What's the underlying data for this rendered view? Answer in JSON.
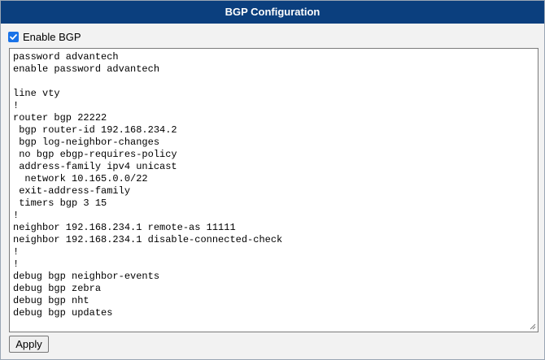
{
  "window": {
    "title": "BGP Configuration"
  },
  "enable_bgp": {
    "label": "Enable BGP",
    "checked": true,
    "check_color": "#1a73e8"
  },
  "config": {
    "text": "password advantech\nenable password advantech\n\nline vty\n!\nrouter bgp 22222\n bgp router-id 192.168.234.2\n bgp log-neighbor-changes\n no bgp ebgp-requires-policy\n address-family ipv4 unicast\n  network 10.165.0.0/22\n exit-address-family\n timers bgp 3 15\n!\nneighbor 192.168.234.1 remote-as 11111\nneighbor 192.168.234.1 disable-connected-check\n!\n!\ndebug bgp neighbor-events\ndebug bgp zebra\ndebug bgp nht\ndebug bgp updates"
  },
  "actions": {
    "apply_label": "Apply"
  },
  "colors": {
    "title_bar": "#0b3f7e",
    "panel_bg": "#f2f2f2"
  },
  "icons": {
    "checkbox": "checkmark-icon",
    "resize": "resize-grip-icon"
  }
}
